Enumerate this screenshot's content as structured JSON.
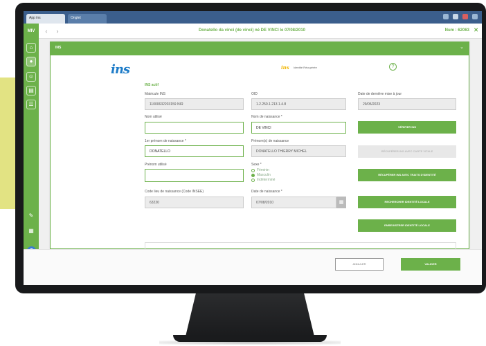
{
  "browser": {
    "tabs": [
      "App ins",
      "Onglet"
    ]
  },
  "header": {
    "app_logo": "MIV",
    "title": "Donatello da vinci (de vinci) né DE VINCI le 07/08/2010",
    "user": "Num : 62063"
  },
  "card": {
    "header_label": "INS",
    "logo": "ins",
    "mini_logo": "ins",
    "mini_text": "Identité Récupérée",
    "section_title": "INS actif"
  },
  "form": {
    "matricule_label": "Matricule INS",
    "matricule_value": "1100063220315​9 NIR",
    "oid_label": "OID",
    "oid_value": "1.2.250.1.213.1.4.8",
    "date_maj_label": "Date de dernière mise à jour",
    "date_maj_value": "29/05/2023",
    "nom_utilise_label": "Nom utilisé",
    "nom_utilise_value": "",
    "nom_naissance_label": "Nom de naissance *",
    "nom_naissance_value": "DE VINCI",
    "prenom1_label": "1er prénom de naissance *",
    "prenom1_value": "DONATELLO",
    "prenoms_label": "Prénom(s) de naissance",
    "prenoms_value": "DONATELLO THIERRY MICHEL",
    "prenom_utilise_label": "Prénom utilisé",
    "prenom_utilise_value": "",
    "sexe_label": "Sexe *",
    "sexe_options": [
      "Féminin",
      "Masculin",
      "Indéterminé"
    ],
    "code_lieu_label": "Code lieu de naissance (Code INSEE)",
    "code_lieu_value": "63220",
    "date_naissance_label": "Date de naissance *",
    "date_naissance_value": "07/08/2010"
  },
  "actions": {
    "verifier": "Vérifier INS",
    "disabled": "Récupérer INS avec carte vitale",
    "recuperer": "Récupérer INS avec traits d'identité",
    "rechercher": "Rechercher identité locale",
    "enregistrer": "Enregistrer identité locale"
  },
  "footer": {
    "cancel": "Annuler",
    "validate": "Valider"
  },
  "colors": {
    "accent": "#6cb14a",
    "ins_blue": "#1e7cc8"
  }
}
